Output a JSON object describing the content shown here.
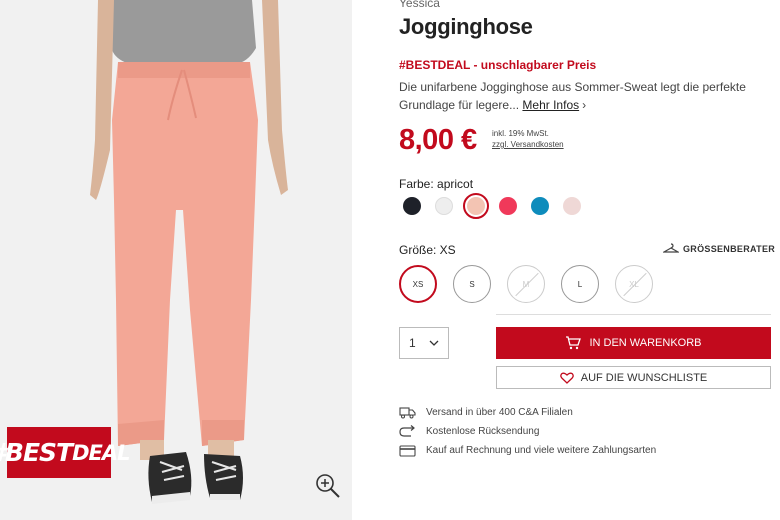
{
  "product": {
    "brand": "Yessica",
    "title": "Jogginghose",
    "promo": "#BESTDEAL - unschlagbarer Preis",
    "description": "Die unifarbene Jogginghose aus Sommer-Sweat legt die perfekte Grundlage für legere...",
    "more_label": "Mehr Infos",
    "price": "8,00 €",
    "vat_note": "inkl. 19% MwSt.",
    "shipping_note": "zzgl. Versandkosten",
    "badge": "#BEST",
    "badge_deal": "DEAL"
  },
  "color": {
    "label": "Farbe: apricot",
    "swatches": [
      {
        "name": "navy",
        "hex": "#1e2129"
      },
      {
        "name": "white",
        "hex": "#eeeeee"
      },
      {
        "name": "apricot",
        "hex": "#f3c4b3",
        "selected": true
      },
      {
        "name": "red",
        "hex": "#f0395a"
      },
      {
        "name": "petrol",
        "hex": "#0e8cbc"
      },
      {
        "name": "rose",
        "hex": "#efd8d6"
      }
    ]
  },
  "size": {
    "label": "Größe: XS",
    "advisor": "GRÖSSENBERATER",
    "options": [
      {
        "label": "XS",
        "state": "selected"
      },
      {
        "label": "S",
        "state": "available"
      },
      {
        "label": "M",
        "state": "disabled"
      },
      {
        "label": "L",
        "state": "available"
      },
      {
        "label": "XL",
        "state": "disabled"
      }
    ]
  },
  "actions": {
    "quantity": "1",
    "cart_label": "IN DEN WARENKORB",
    "wishlist_label": "AUF DIE WUNSCHLISTE"
  },
  "benefits": [
    {
      "icon": "truck-icon",
      "text": "Versand in über 400 C&A Filialen"
    },
    {
      "icon": "return-icon",
      "text": "Kostenlose Rücksendung"
    },
    {
      "icon": "card-icon",
      "text": "Kauf auf Rechnung und viele weitere Zahlungsarten"
    }
  ],
  "colors": {
    "accent": "#c20a1d"
  }
}
